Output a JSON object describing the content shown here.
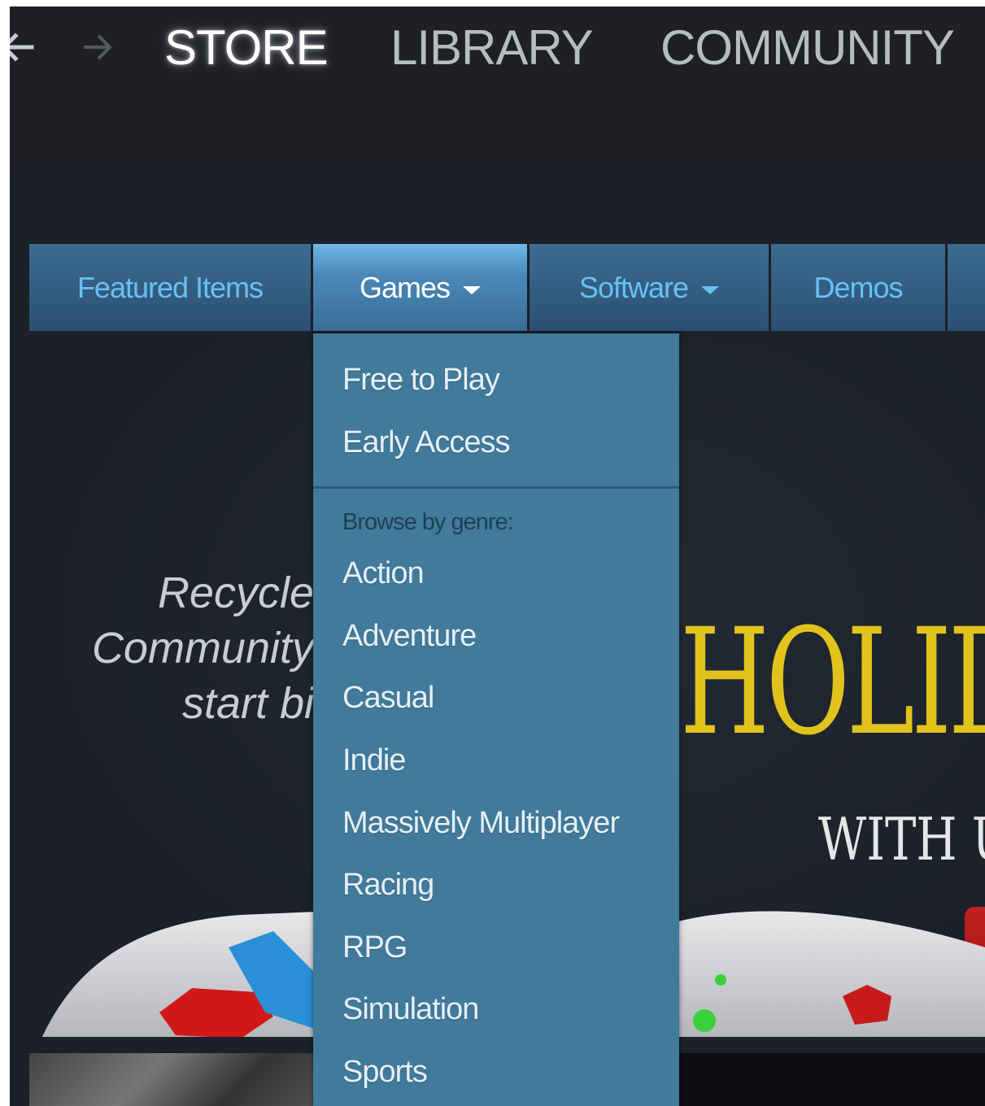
{
  "header": {
    "tabs": [
      {
        "label": "STORE",
        "active": true
      },
      {
        "label": "LIBRARY",
        "active": false
      },
      {
        "label": "COMMUNITY",
        "active": false
      }
    ]
  },
  "subnav": {
    "tabs": [
      {
        "label": "Featured Items"
      },
      {
        "label": "Games",
        "active": true
      },
      {
        "label": "Software"
      },
      {
        "label": "Demos"
      }
    ]
  },
  "games_menu": {
    "items": [
      "Free to Play",
      "Early Access"
    ],
    "genre_heading": "Browse by genre:",
    "genres": [
      "Action",
      "Adventure",
      "Casual",
      "Indie",
      "Massively Multiplayer",
      "Racing",
      "RPG",
      "Simulation",
      "Sports"
    ]
  },
  "hero": {
    "left_text": [
      "Recycle",
      "Community",
      "start bi"
    ],
    "title": "HOLID",
    "subtitle": "WITH U"
  },
  "colors": {
    "subnav_text": "#67c1f5",
    "dropdown_bg": "#417a9b",
    "holiday_yellow": "#e0c31c"
  }
}
